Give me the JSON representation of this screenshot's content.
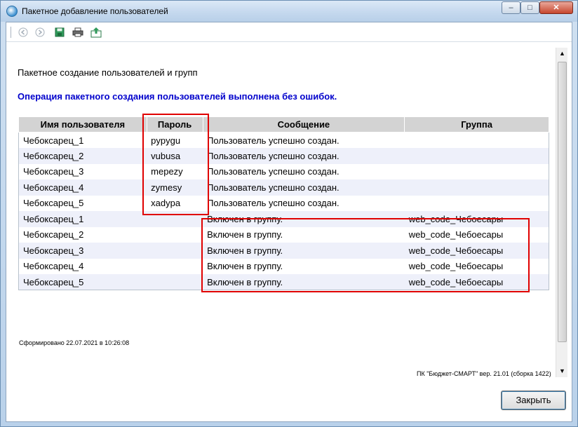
{
  "window": {
    "title": "Пакетное добавление пользователей",
    "controls": {
      "minimize": "–",
      "maximize": "□",
      "close": "✕"
    }
  },
  "toolbar": {
    "icons": [
      "back-icon",
      "forward-icon",
      "save-icon",
      "print-icon",
      "export-icon"
    ]
  },
  "report": {
    "title": "Пакетное создание пользователей и групп",
    "status": "Операция пакетного создания пользователей выполнена без ошибок.",
    "columns": [
      "Имя пользователя",
      "Пароль",
      "Сообщение",
      "Группа"
    ],
    "rows": [
      {
        "user": "Чебоксарец_1",
        "password": "pypygu",
        "message": "Пользователь успешно создан.",
        "group": ""
      },
      {
        "user": "Чебоксарец_2",
        "password": "vubusa",
        "message": "Пользователь успешно создан.",
        "group": ""
      },
      {
        "user": "Чебоксарец_3",
        "password": "mepezy",
        "message": "Пользователь успешно создан.",
        "group": ""
      },
      {
        "user": "Чебоксарец_4",
        "password": "zymesy",
        "message": "Пользователь успешно создан.",
        "group": ""
      },
      {
        "user": "Чебоксарец_5",
        "password": "xadypa",
        "message": "Пользователь успешно создан.",
        "group": ""
      },
      {
        "user": "Чебоксарец_1",
        "password": "",
        "message": "Включен в группу.",
        "group": "web_code_Чебоесары"
      },
      {
        "user": "Чебоксарец_2",
        "password": "",
        "message": "Включен в группу.",
        "group": "web_code_Чебоесары"
      },
      {
        "user": "Чебоксарец_3",
        "password": "",
        "message": "Включен в группу.",
        "group": "web_code_Чебоесары"
      },
      {
        "user": "Чебоксарец_4",
        "password": "",
        "message": "Включен в группу.",
        "group": "web_code_Чебоесары"
      },
      {
        "user": "Чебоксарец_5",
        "password": "",
        "message": "Включен в группу.",
        "group": "web_code_Чебоесары"
      }
    ],
    "generated": "Сформировано 22.07.2021 в 10:26:08",
    "version": "ПК \"Бюджет-СМАРТ\" вер. 21.01 (сборка 1422)"
  },
  "buttons": {
    "close_label": "Закрыть"
  },
  "colors": {
    "status_text": "#0000cc",
    "highlight": "#e00000",
    "header_bg": "#d3d3d3",
    "row_alt_bg": "#eef0fa"
  }
}
